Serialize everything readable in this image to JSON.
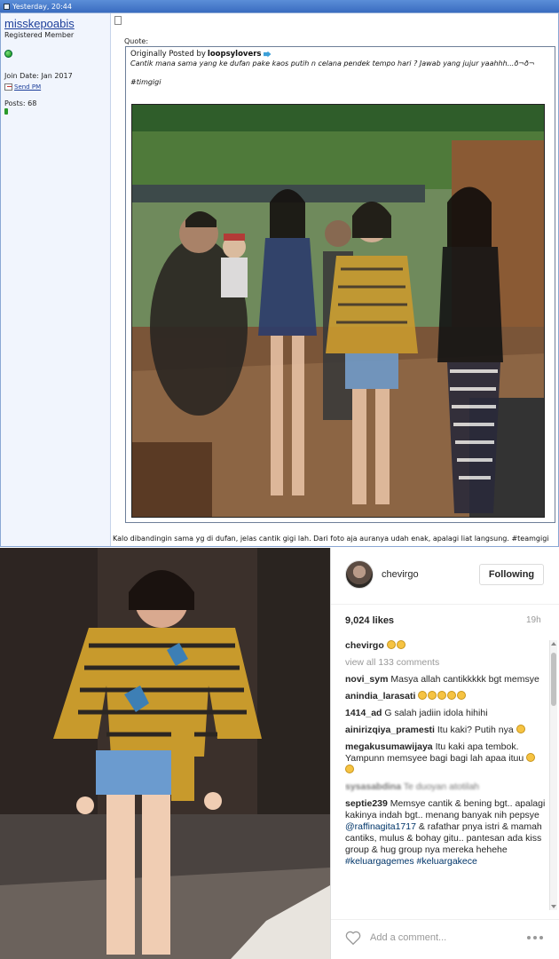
{
  "titlebar": {
    "text": "Yesterday, 20:44"
  },
  "user": {
    "name": "misskepoabis",
    "role": "Registered Member",
    "join_date": "Join Date: Jan 2017",
    "send_pm": "Send PM",
    "posts": "Posts: 68"
  },
  "quote": {
    "label": "Quote:",
    "posted_by_prefix": "Originally Posted by",
    "author": "loopsylovers",
    "text": "Cantik mana sama yang ke dufan pake kaos putih n celana pendek tempo hari ? Jawab yang jujur yaahhh...ð¬ð¬",
    "tag": "#timgigi"
  },
  "post": {
    "caption": "Kalo dibandingin sama yg di dufan, jelas cantik gigi lah. Dari foto aja auranya udah enak, apalagi liat langsung. #teamgigi"
  },
  "instagram": {
    "username": "chevirgo",
    "follow_label": "Following",
    "likes": "9,024 likes",
    "time": "19h",
    "view_all": "view all 133 comments",
    "comments": [
      {
        "user": "chevirgo",
        "text": ""
      },
      {
        "user": "novi_sym",
        "text": "Masya allah cantikkkkk bgt memsye"
      },
      {
        "user": "anindia_larasati",
        "text": ""
      },
      {
        "user": "1414_ad",
        "text": "G salah jadiin idola hihihi"
      },
      {
        "user": "ainirizqiya_pramesti",
        "text": "Itu kaki? Putih nya"
      },
      {
        "user": "megakusumawijaya",
        "text": "Itu kaki apa tembok. Yampunn memsyee bagi bagi lah apaa ituu"
      },
      {
        "user": "sysasabdina",
        "text": "Te duoyan atotilah"
      },
      {
        "user": "septie239",
        "text": "Memsye cantik & bening bgt.. apalagi kakinya indah bgt.. menang banyak nih pepsye",
        "mention": "@raffinagita1717",
        "text2": "& rafathar pnya istri & mamah cantiks, mulus & bohay gitu.. pantesan ada kiss group & hug group nya mereka hehehe",
        "tags": "#keluargagemes #keluargakece"
      }
    ],
    "add_comment_placeholder": "Add a comment..."
  }
}
